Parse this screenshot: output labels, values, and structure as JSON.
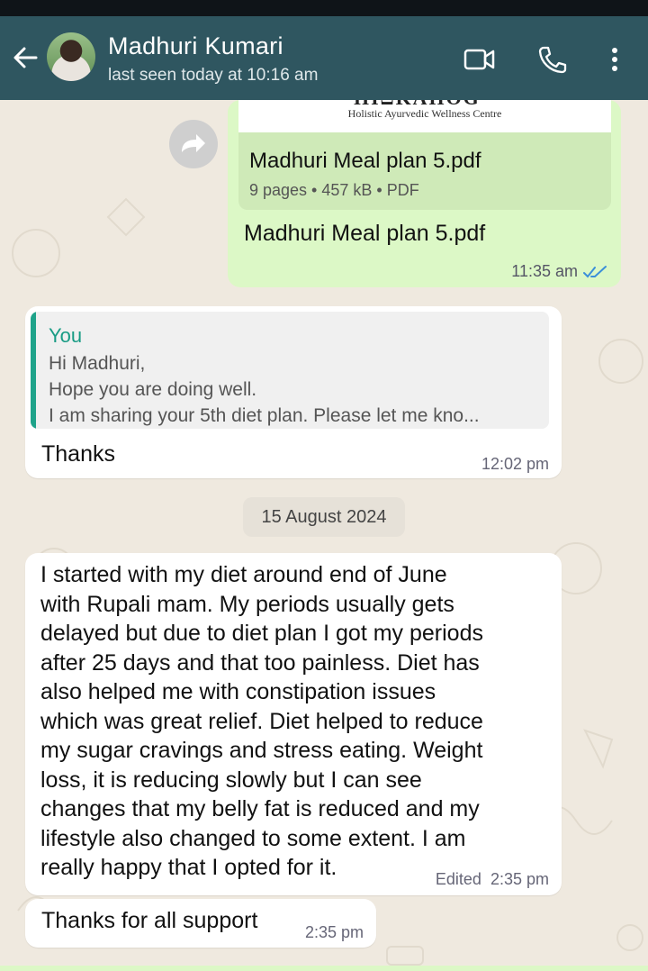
{
  "header": {
    "contact_name": "Madhuri Kumari",
    "last_seen": "last seen today at 10:16 am"
  },
  "pdf_message": {
    "thumb_subtitle": "Holistic Ayurvedic Wellness Centre",
    "file_name": "Madhuri Meal plan 5.pdf",
    "meta": "9 pages • 457 kB • PDF",
    "caption": "Madhuri Meal plan 5.pdf",
    "time": "11:35 am"
  },
  "reply_message": {
    "quote_author": "You",
    "quote_lines": [
      "Hi Madhuri,",
      "Hope you are doing well.",
      "I am sharing your 5th diet plan. Please let me kno..."
    ],
    "text": "Thanks",
    "time": "12:02 pm"
  },
  "date_separator": "15 August 2024",
  "long_message": {
    "lines": [
      "I started with my diet around end of June",
      "with Rupali mam. My periods usually gets",
      "delayed but due to diet plan I got my periods",
      "after 25 days and that too painless. Diet has",
      "also helped me with constipation issues",
      "which was great relief. Diet helped to reduce",
      "my sugar cravings and stress eating. Weight",
      "loss, it is reducing slowly but I can see",
      "changes that my belly fat is reduced and my",
      "lifestyle also changed to some extent. I am",
      "really happy that I opted for it."
    ],
    "time": "Edited  2:35 pm"
  },
  "short_message": {
    "text": "Thanks for all support",
    "time": "2:35 pm"
  },
  "icons": [
    "back-arrow-icon",
    "video-call-icon",
    "phone-icon",
    "more-options-icon",
    "forward-icon",
    "double-check-icon"
  ],
  "colors": {
    "header": "#2f5660",
    "outgoing_bubble": "#dcf8c6",
    "incoming_bubble": "#ffffff",
    "quote_accent": "#1fa38a",
    "read_ticks": "#3b8fd9"
  }
}
